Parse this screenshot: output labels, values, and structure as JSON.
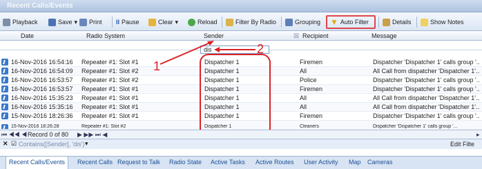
{
  "window": {
    "title": "Recent Calls/Events"
  },
  "toolbar": {
    "playback": "Playback",
    "save": "Save",
    "print": "Print",
    "pause": "Pause",
    "clear": "Clear",
    "reload": "Reload",
    "filter_by_radio": "Filter By Radio",
    "grouping": "Grouping",
    "auto_filter": "Auto Filter",
    "details": "Details",
    "show_notes": "Show Notes"
  },
  "columns": {
    "date": "Date",
    "radio_system": "Radio System",
    "sender": "Sender",
    "recipient": "Recipient",
    "message": "Message"
  },
  "filter": {
    "sender_value": "dis"
  },
  "rows": [
    {
      "date": "16-Nov-2016 16:54:16",
      "radio": "Repeater #1: Slot #1",
      "sender": "Dispatcher 1",
      "recipient": "Firemen",
      "message": "Dispatcher 'Dispatcher 1' calls group '..."
    },
    {
      "date": "16-Nov-2016 16:54:09",
      "radio": "Repeater #1: Slot #2",
      "sender": "Dispatcher 1",
      "recipient": "All",
      "message": "All Call from dispatcher 'Dispatcher 1'..."
    },
    {
      "date": "16-Nov-2016 16:53:57",
      "radio": "Repeater #1: Slot #2",
      "sender": "Dispatcher 1",
      "recipient": "Police",
      "message": "Dispatcher 'Dispatcher 1' calls group '..."
    },
    {
      "date": "16-Nov-2016 16:53:57",
      "radio": "Repeater #1: Slot #1",
      "sender": "Dispatcher 1",
      "recipient": "Firemen",
      "message": "Dispatcher 'Dispatcher 1' calls group '..."
    },
    {
      "date": "16-Nov-2016 15:35:23",
      "radio": "Repeater #1: Slot #1",
      "sender": "Dispatcher 1",
      "recipient": "All",
      "message": "All Call from dispatcher 'Dispatcher 1'..."
    },
    {
      "date": "16-Nov-2016 15:35:16",
      "radio": "Repeater #1: Slot #1",
      "sender": "Dispatcher 1",
      "recipient": "All",
      "message": "All Call from dispatcher 'Dispatcher 1'..."
    },
    {
      "date": "15-Nov-2016 18:26:36",
      "radio": "Repeater #1: Slot #1",
      "sender": "Dispatcher 1",
      "recipient": "Firemen",
      "message": "Dispatcher 'Dispatcher 1' calls group '..."
    },
    {
      "date": "15-Nov-2016 18:26:28",
      "radio": "Repeater #1: Slot #2",
      "sender": "Dispatcher 1",
      "recipient": "Cleaners",
      "message": "Dispatcher 'Dispatcher 1' calls group '..."
    }
  ],
  "pager": {
    "record_text": "Record 0 of 80"
  },
  "status": {
    "filter_expression": "Contains([Sender], 'dis')",
    "edit_filter": "Edit Filte"
  },
  "annotations": {
    "one": "1",
    "two": "2"
  },
  "tabs": [
    "Recent Calls/Events",
    "Recent Calls",
    "Request to Talk",
    "Radio State",
    "Active Tasks",
    "Active Routes",
    "User Activity",
    "Map",
    "Cameras"
  ],
  "colors": {
    "highlight": "#e0454a",
    "annotation": "#d92226"
  }
}
